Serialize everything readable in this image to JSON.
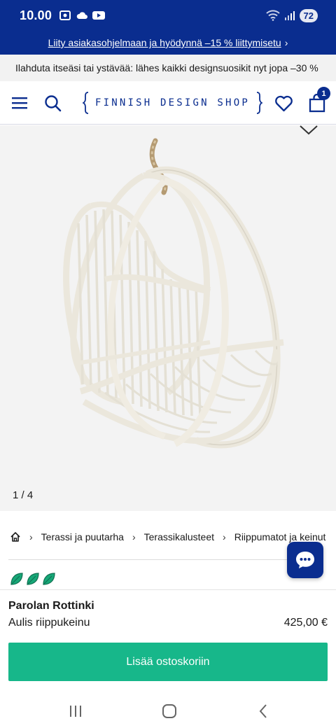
{
  "status_bar": {
    "time": "10.00",
    "battery": "72"
  },
  "promo_banner": {
    "text": "Liity asiakasohjelmaan ja hyödynnä –15 % liittymisetu",
    "chevron": "›"
  },
  "info_strip": {
    "text": "Ilahduta itseäsi tai ystävää: lähes kaikki designsuosikit nyt jopa –30 %"
  },
  "header": {
    "logo_text": "FINNISH DESIGN SHOP",
    "cart_count": "1",
    "icons": [
      "menu-icon",
      "search-icon",
      "heart-icon",
      "cart-icon"
    ]
  },
  "gallery": {
    "counter": "1 / 4"
  },
  "breadcrumb": {
    "items": [
      "Terassi ja puutarha",
      "Terassikalusteet",
      "Riippumatot ja keinut"
    ]
  },
  "product": {
    "brand": "Parolan Rottinki",
    "name": "Aulis riippukeinu",
    "price": "425,00 €",
    "eco_leaves": 3,
    "add_to_cart_label": "Lisää ostoskoriin"
  },
  "colors": {
    "brand_blue": "#0a2d8f",
    "cta_green": "#17b78a",
    "leaf_green": "#17a777"
  }
}
